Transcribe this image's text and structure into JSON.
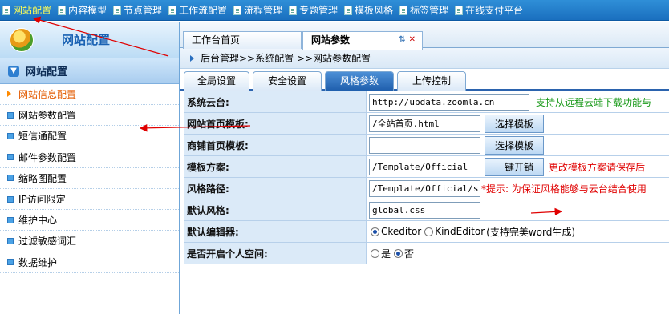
{
  "top_menu": [
    "网站配置",
    "内容模型",
    "节点管理",
    "工作流配置",
    "流程管理",
    "专题管理",
    "模板风格",
    "标签管理",
    "在线支付平台"
  ],
  "sidebar": {
    "title": "网站配置",
    "section": "网站配置",
    "items": [
      "网站信息配置",
      "网站参数配置",
      "短信通配置",
      "邮件参数配置",
      "缩略图配置",
      "IP访问限定",
      "维护中心",
      "过滤敏感词汇",
      "数据维护"
    ]
  },
  "page_tabs": {
    "home": "工作台首页",
    "current": "网站参数",
    "ctrls": "⇅"
  },
  "breadcrumb": "后台管理>>系统配置 >>网站参数配置",
  "sub_tabs": [
    "全局设置",
    "安全设置",
    "风格参数",
    "上传控制"
  ],
  "form": {
    "cloud": {
      "label": "系统云台:",
      "value": "http://updata.zoomla.cn",
      "hint": "支持从远程云端下载功能与"
    },
    "home_tpl": {
      "label": "网站首页模板:",
      "value": "/全站首页.html",
      "button": "选择模板"
    },
    "shop_tpl": {
      "label": "商铺首页模板:",
      "value": "",
      "button": "选择模板"
    },
    "scheme": {
      "label": "模板方案:",
      "value": "/Template/Official",
      "button": "一键开销",
      "hint": "更改模板方案请保存后"
    },
    "style_path": {
      "label": "风格路径:",
      "value": "/Template/Official/st",
      "hint": "*提示: 为保证风格能够与云台结合使用"
    },
    "default_style": {
      "label": "默认风格:",
      "value": "global.css"
    },
    "editor": {
      "label": "默认编辑器:",
      "opt1": "Ckeditor",
      "opt2": "KindEditor",
      "note": "(支持完美word生成)"
    },
    "personal_space": {
      "label": "是否开启个人空间:",
      "yes": "是",
      "no": "否"
    }
  },
  "colors": {
    "topbar": "#1a6fbf",
    "accent_orange": "#e35b00",
    "hint_red": "#e00000",
    "hint_green": "#1a9a1a"
  }
}
